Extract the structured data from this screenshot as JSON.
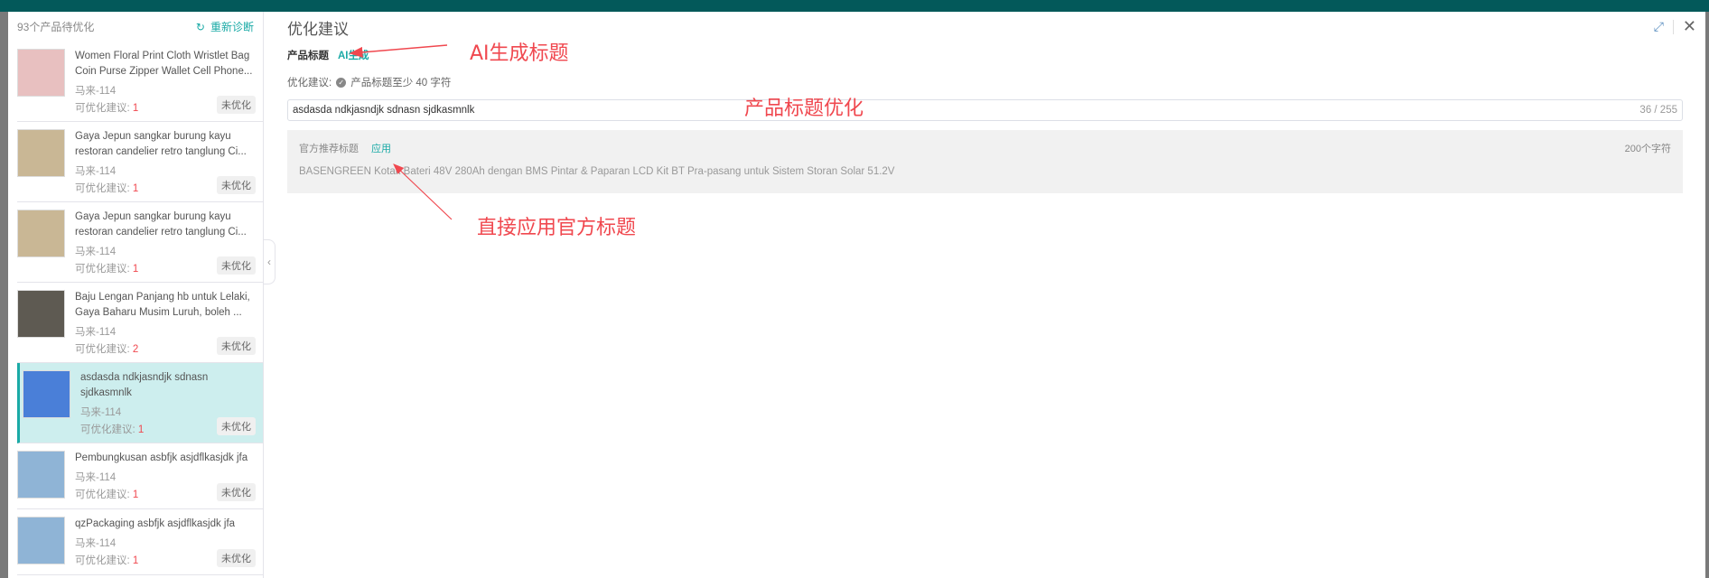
{
  "left_panel": {
    "count_label": "93个产品待优化",
    "rediagnose_label": "重新诊断",
    "items": [
      {
        "title": "Women Floral Print Cloth Wristlet Bag Coin Purse Zipper Wallet Cell Phone...",
        "site": "马来-114",
        "suggest_label": "可优化建议:",
        "suggest_count": "1",
        "status": "未优化",
        "thumb": "#e8c0c0"
      },
      {
        "title": "Gaya Jepun sangkar burung kayu restoran candelier retro tanglung Ci...",
        "site": "马来-114",
        "suggest_label": "可优化建议:",
        "suggest_count": "1",
        "status": "未优化",
        "thumb": "#c9b795"
      },
      {
        "title": "Gaya Jepun sangkar burung kayu restoran candelier retro tanglung Ci...",
        "site": "马来-114",
        "suggest_label": "可优化建议:",
        "suggest_count": "1",
        "status": "未优化",
        "thumb": "#c9b795"
      },
      {
        "title": "Baju Lengan Panjang hb untuk Lelaki, Gaya Baharu Musim Luruh, boleh ...",
        "site": "马来-114",
        "suggest_label": "可优化建议:",
        "suggest_count": "2",
        "status": "未优化",
        "thumb": "#5e5a52"
      },
      {
        "title": "asdasda ndkjasndjk sdnasn sjdkasmnlk",
        "site": "马来-114",
        "suggest_label": "可优化建议:",
        "suggest_count": "1",
        "status": "未优化",
        "thumb": "#4a7fd8"
      },
      {
        "title": "Pembungkusan asbfjk asjdflkasjdk jfa",
        "site": "马来-114",
        "suggest_label": "可优化建议:",
        "suggest_count": "1",
        "status": "未优化",
        "thumb": "#8fb4d6"
      },
      {
        "title": "qzPackaging asbfjk asjdflkasjdk jfa",
        "site": "马来-114",
        "suggest_label": "可优化建议:",
        "suggest_count": "1",
        "status": "未优化",
        "thumb": "#8fb4d6"
      }
    ]
  },
  "main": {
    "title": "优化建议",
    "product_title_label": "产品标题",
    "ai_generate_label": "AI生成",
    "suggest_label": "优化建议:",
    "suggest_text": "产品标题至少 40 字符",
    "title_input_value": "asdasda ndkjasndjk sdnasn sjdkasmnlk",
    "title_counter": "36 / 255",
    "official_label": "官方推荐标题",
    "apply_label": "应用",
    "official_chars": "200个字符",
    "official_title": "BASENGREEN Kotak Bateri 48V 280Ah dengan BMS Pintar & Paparan LCD Kit BT Pra-pasang untuk Sistem Storan Solar 51.2V"
  },
  "annotations": {
    "ai_title": "AI生成标题",
    "title_opt": "产品标题优化",
    "apply_official": "直接应用官方标题"
  },
  "colors": {
    "accent": "#1aaaa6",
    "annotation": "#f0484f",
    "topbar": "#03595a"
  }
}
